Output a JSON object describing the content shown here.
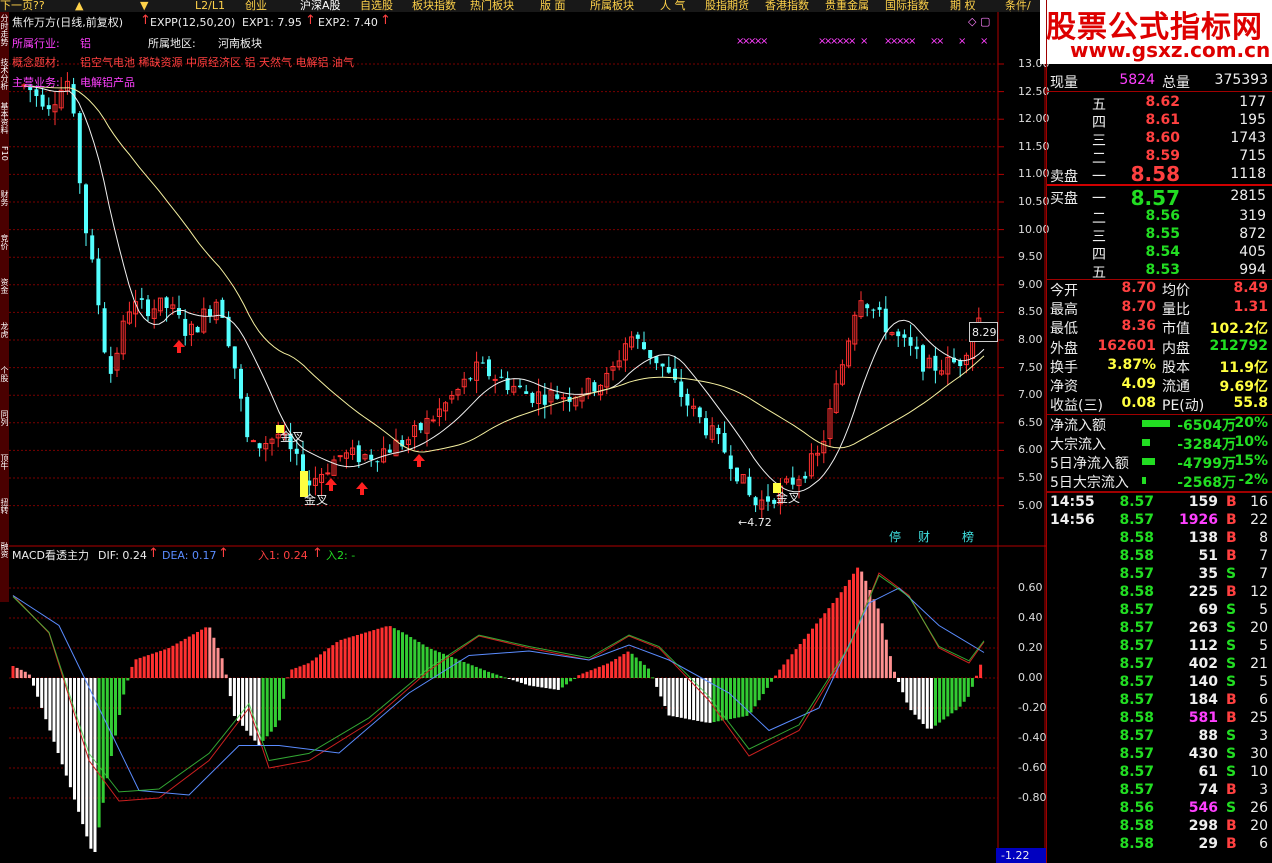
{
  "topnav": [
    "下一页??",
    "▲",
    "▼",
    "L2/L1",
    "创业",
    "沪深A股",
    "自选股",
    "板块指数",
    "热门板块",
    "版 面",
    "所属板块",
    "人 气",
    "股指期货",
    "香港指数",
    "贵重金属",
    "国际指数",
    "期 权",
    "条件/内线"
  ],
  "sidebar_tabs": [
    "分时走势",
    "技术分析",
    "基本资料",
    "F10",
    "财务",
    "竞价",
    "资金",
    "龙虎",
    "个股",
    "同列",
    "顶牛",
    "扭转",
    "融资"
  ],
  "header": {
    "stock_label": "焦作万方(日线,前复权)",
    "indicator": "EXPP(12,50,20)",
    "exp1": "EXP1: 7.95",
    "exp2": "EXP2: 7.40",
    "industry_label": "所属行业:",
    "industry": "铝",
    "region_label": "所属地区:",
    "region": "河南板块",
    "concept_label": "概念题材:",
    "concepts": "铝空气电池 稀缺资源 中原经济区 铝 天然气 电解铝 油气",
    "business_label": "主营业务:",
    "business": "电解铝产品",
    "window_icons": "◇ ▢"
  },
  "price_axis": [
    "13.00",
    "12.50",
    "12.00",
    "11.50",
    "11.00",
    "10.50",
    "10.00",
    "9.50",
    "9.00",
    "8.50",
    "8.00",
    "7.50",
    "7.00",
    "6.50",
    "6.00",
    "5.50",
    "5.00"
  ],
  "price_annotations": {
    "last_price": "8.29",
    "low_price": "4.72",
    "golden_cross": "金叉",
    "bottom_tabs": [
      "停",
      "财",
      "榜"
    ]
  },
  "macd": {
    "title": "MACD看透主力",
    "dif": "DIF: 0.24",
    "dea": "DEA: 0.17",
    "in1": "入1: 0.24",
    "in2": "入2: -",
    "axis": [
      "0.60",
      "0.40",
      "0.20",
      "0.00",
      "-0.20",
      "-0.40",
      "-0.60",
      "-0.80"
    ],
    "bottom_value": "-1.22"
  },
  "logo": {
    "title": "股票公式指标网",
    "url": "www.gsxz.com.cn"
  },
  "quote": {
    "volume_now_label": "现量",
    "volume_now": "5824",
    "volume_total_label": "总量",
    "volume_total": "375393",
    "sell_label": "卖盘",
    "buy_label": "买盘",
    "sells": [
      {
        "lvl": "五",
        "price": "8.62",
        "vol": "177"
      },
      {
        "lvl": "四",
        "price": "8.61",
        "vol": "195"
      },
      {
        "lvl": "三",
        "price": "8.60",
        "vol": "1743"
      },
      {
        "lvl": "二",
        "price": "8.59",
        "vol": "715"
      },
      {
        "lvl": "一",
        "price": "8.58",
        "vol": "1118"
      }
    ],
    "buys": [
      {
        "lvl": "一",
        "price": "8.57",
        "vol": "2815"
      },
      {
        "lvl": "二",
        "price": "8.56",
        "vol": "319"
      },
      {
        "lvl": "三",
        "price": "8.55",
        "vol": "872"
      },
      {
        "lvl": "四",
        "price": "8.54",
        "vol": "405"
      },
      {
        "lvl": "五",
        "price": "8.53",
        "vol": "994"
      }
    ],
    "stats": [
      {
        "l1": "今开",
        "v1": "8.70",
        "l2": "均价",
        "v2": "8.49"
      },
      {
        "l1": "最高",
        "v1": "8.70",
        "l2": "量比",
        "v2": "1.31"
      },
      {
        "l1": "最低",
        "v1": "8.36",
        "l2": "市值",
        "v2": "102.2亿"
      },
      {
        "l1": "外盘",
        "v1": "162601",
        "l2": "内盘",
        "v2": "212792"
      },
      {
        "l1": "换手",
        "v1": "3.87%",
        "l2": "股本",
        "v2": "11.9亿"
      },
      {
        "l1": "净资",
        "v1": "4.09",
        "l2": "流通",
        "v2": "9.69亿"
      },
      {
        "l1": "收益(三)",
        "v1": "0.08",
        "l2": "PE(动)",
        "v2": "55.8"
      }
    ],
    "flows": [
      {
        "label": "净流入额",
        "value": "-6504万",
        "pct": "-20%",
        "fill": 1.0
      },
      {
        "label": "大宗流入",
        "value": "-3284万",
        "pct": "-10%",
        "fill": 0.3
      },
      {
        "label": "5日净流入额",
        "value": "-4799万",
        "pct": "-15%",
        "fill": 0.45
      },
      {
        "label": "5日大宗流入",
        "value": "-2568万",
        "pct": "-2%",
        "fill": 0.15
      }
    ],
    "ticks": [
      {
        "t": "14:55",
        "p": "8.57",
        "v": "159",
        "s": "B",
        "n": "16"
      },
      {
        "t": "14:56",
        "p": "8.57",
        "v": "1926",
        "s": "B",
        "n": "22"
      },
      {
        "t": "",
        "p": "8.58",
        "v": "138",
        "s": "B",
        "n": "8"
      },
      {
        "t": "",
        "p": "8.58",
        "v": "51",
        "s": "B",
        "n": "7"
      },
      {
        "t": "",
        "p": "8.57",
        "v": "35",
        "s": "S",
        "n": "7"
      },
      {
        "t": "",
        "p": "8.58",
        "v": "225",
        "s": "B",
        "n": "12"
      },
      {
        "t": "",
        "p": "8.57",
        "v": "69",
        "s": "S",
        "n": "5"
      },
      {
        "t": "",
        "p": "8.57",
        "v": "263",
        "s": "S",
        "n": "20"
      },
      {
        "t": "",
        "p": "8.57",
        "v": "112",
        "s": "S",
        "n": "5"
      },
      {
        "t": "",
        "p": "8.57",
        "v": "402",
        "s": "S",
        "n": "21"
      },
      {
        "t": "",
        "p": "8.57",
        "v": "140",
        "s": "S",
        "n": "5"
      },
      {
        "t": "",
        "p": "8.57",
        "v": "184",
        "s": "B",
        "n": "6"
      },
      {
        "t": "",
        "p": "8.58",
        "v": "581",
        "s": "B",
        "n": "25"
      },
      {
        "t": "",
        "p": "8.57",
        "v": "88",
        "s": "S",
        "n": "3"
      },
      {
        "t": "",
        "p": "8.57",
        "v": "430",
        "s": "S",
        "n": "30"
      },
      {
        "t": "",
        "p": "8.57",
        "v": "61",
        "s": "S",
        "n": "10"
      },
      {
        "t": "",
        "p": "8.57",
        "v": "74",
        "s": "B",
        "n": "3"
      },
      {
        "t": "",
        "p": "8.56",
        "v": "546",
        "s": "S",
        "n": "26"
      },
      {
        "t": "",
        "p": "8.58",
        "v": "298",
        "s": "B",
        "n": "20"
      },
      {
        "t": "",
        "p": "8.58",
        "v": "29",
        "s": "B",
        "n": "6"
      }
    ]
  }
}
